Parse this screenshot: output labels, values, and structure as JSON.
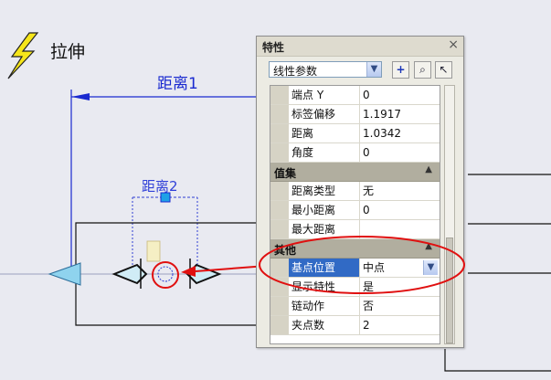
{
  "canvas": {
    "command_label": "拉伸",
    "dimension_large": "距离1",
    "dimension_small": "距离2"
  },
  "palette": {
    "title": "特性",
    "close_glyph": "×",
    "object_type": "线性参数",
    "tools": [
      {
        "icon": "quick-select-icon",
        "glyph": "+"
      },
      {
        "icon": "select-objects-icon",
        "glyph": "⌕"
      },
      {
        "icon": "toggle-pickadd-icon",
        "glyph": "↖"
      }
    ],
    "rows": [
      {
        "kind": "prop",
        "name": "端点 Y",
        "value": "0"
      },
      {
        "kind": "prop",
        "name": "标签偏移",
        "value": "1.1917"
      },
      {
        "kind": "prop",
        "name": "距离",
        "value": "1.0342"
      },
      {
        "kind": "prop",
        "name": "角度",
        "value": "0"
      },
      {
        "kind": "category",
        "name": "值集"
      },
      {
        "kind": "prop",
        "name": "距离类型",
        "value": "无"
      },
      {
        "kind": "prop",
        "name": "最小距离",
        "value": "0"
      },
      {
        "kind": "prop",
        "name": "最大距离",
        "value": ""
      },
      {
        "kind": "category",
        "name": "其他"
      },
      {
        "kind": "prop",
        "name": "基点位置",
        "value": "中点",
        "selected": true,
        "dropdown": true
      },
      {
        "kind": "prop",
        "name": "显示特性",
        "value": "是"
      },
      {
        "kind": "prop",
        "name": "链动作",
        "value": "否"
      },
      {
        "kind": "prop",
        "name": "夹点数",
        "value": "2"
      }
    ]
  },
  "colors": {
    "canvas_bg": "#e9eaf1",
    "dimension": "#1a2ad0",
    "annotation_red": "#e01010",
    "lightning": "#f6e61a",
    "grip_cyan": "#8fd3ee"
  }
}
